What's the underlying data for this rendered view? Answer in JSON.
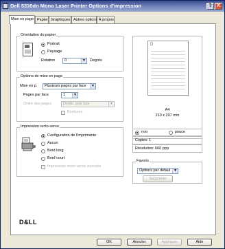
{
  "window": {
    "title": "Dell 5330dn Mono Laser Printer Options d'impression",
    "help_button": "?",
    "close_button": "X"
  },
  "tabs": [
    {
      "label": "Mise en page",
      "active": true
    },
    {
      "label": "Papier",
      "active": false
    },
    {
      "label": "Graphiques",
      "active": false
    },
    {
      "label": "Autres options",
      "active": false
    },
    {
      "label": "À propos",
      "active": false
    }
  ],
  "orientation": {
    "title": "Orientation du papier",
    "portrait": "Portrait",
    "landscape": "Paysage",
    "rotation_label": "Rotation",
    "rotation_value": "0",
    "rotation_unit": "Degrés"
  },
  "layout": {
    "title": "Options de mise en page",
    "type_label": "Mise en p.",
    "type_value": "Plusieurs pages par face",
    "pages_label": "Pages par face",
    "pages_value": "1",
    "order_label": "Ordre des pages",
    "order_value": "Droite, puis bas",
    "borders_label": "Bordures"
  },
  "duplex": {
    "title": "Impression recto-verso",
    "options": [
      "Configuration de l'imprimante",
      "Aucun",
      "Bord long",
      "Bord court"
    ],
    "reverse_label": "Impression recto-verso inversée"
  },
  "preview": {
    "sheet_letter": "D",
    "paper_name": "A4",
    "paper_size": "210 x 297 mm"
  },
  "units": {
    "mm": "mm",
    "inch": "pouce"
  },
  "copies": "Copies: 1",
  "resolution": "Résolution: 600 ppp",
  "favorites": {
    "title": "Favoris",
    "value": "Options par défaut",
    "delete_label": "Supprimer"
  },
  "brand": "D&LL",
  "buttons": {
    "ok": "OK",
    "cancel": "Annuler",
    "apply": "Appliquer",
    "help": "Aide"
  }
}
